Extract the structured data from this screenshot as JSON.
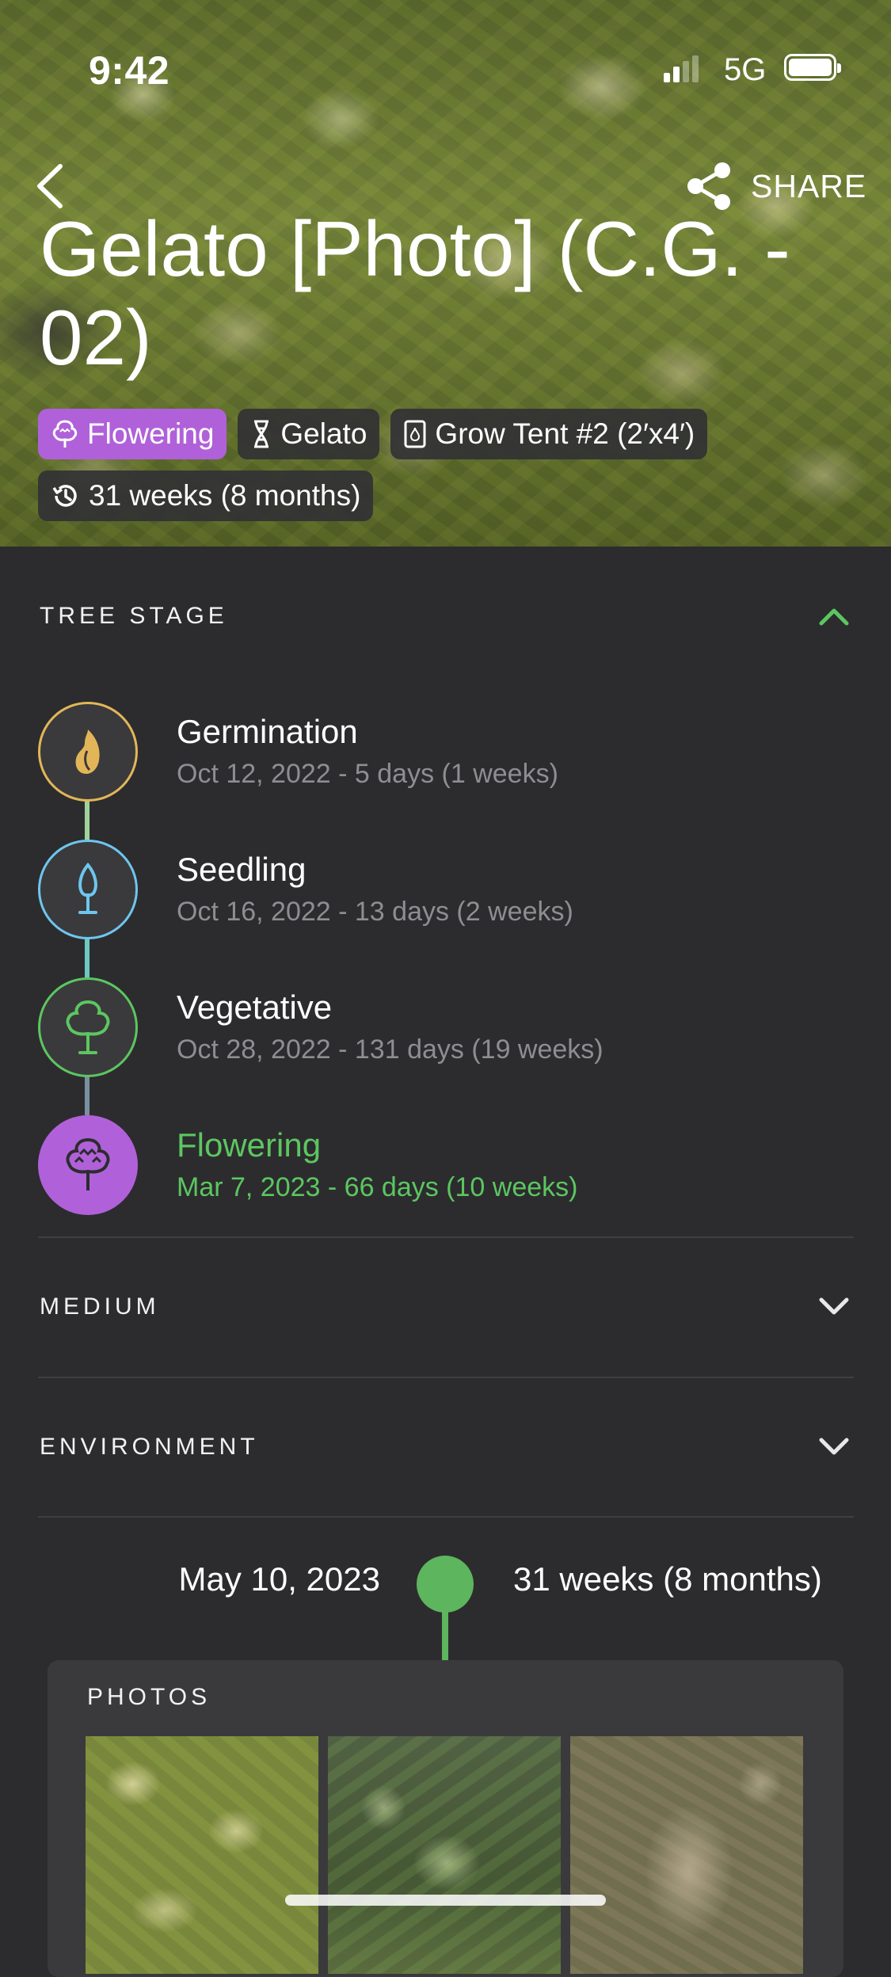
{
  "status": {
    "time": "9:42",
    "network": "5G"
  },
  "header": {
    "share_label": "SHARE",
    "title": "Gelato [Photo] (C.G. - 02)"
  },
  "tags": {
    "stage": "Flowering",
    "strain": "Gelato",
    "location": "Grow Tent #2 (2′x4′)",
    "age": "31 weeks (8 months)"
  },
  "tree_stage": {
    "label": "TREE STAGE",
    "stages": [
      {
        "name": "Germination",
        "dates": "Oct 12, 2022 - 5 days (1 weeks)",
        "color": "#e2b658"
      },
      {
        "name": "Seedling",
        "dates": "Oct 16, 2022 - 13 days (2 weeks)",
        "color": "#6ec6ee"
      },
      {
        "name": "Vegetative",
        "dates": "Oct 28, 2022 - 131 days (19 weeks)",
        "color": "#5cc661"
      },
      {
        "name": "Flowering",
        "dates": "Mar 7, 2023 - 66 days (10 weeks)",
        "color": "#b061d9",
        "active": true
      }
    ]
  },
  "medium": {
    "label": "MEDIUM"
  },
  "environment": {
    "label": "ENVIRONMENT"
  },
  "timeline": {
    "date": "May 10, 2023",
    "age": "31 weeks (8 months)"
  },
  "photos": {
    "label": "PHOTOS"
  },
  "colors": {
    "accent_green": "#5cc661",
    "accent_purple": "#b061d9",
    "background": "#2c2c2e"
  }
}
